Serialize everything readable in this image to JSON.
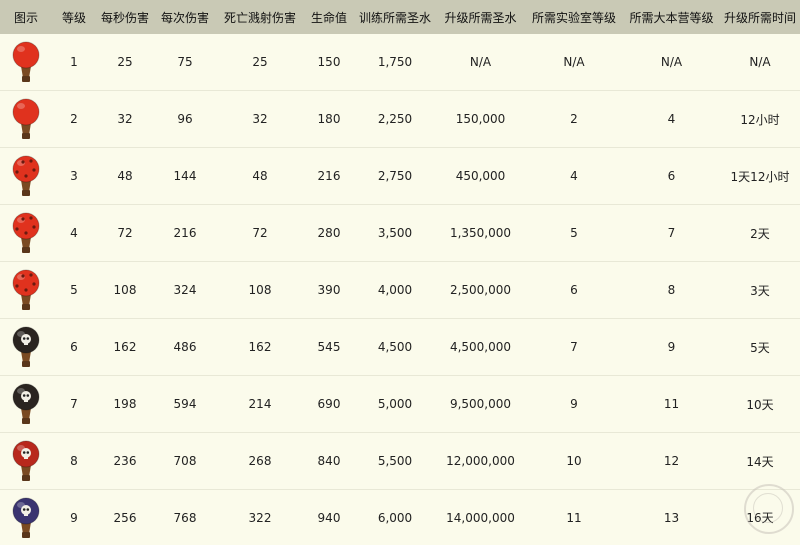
{
  "columns": [
    "图示",
    "等级",
    "每秒伤害",
    "每次伤害",
    "死亡溅射伤害",
    "生命值",
    "训练所需圣水",
    "升级所需圣水",
    "所需实验室等级",
    "所需大本营等级",
    "升级所需时间"
  ],
  "balloon_colors": {
    "red": "#e0321e",
    "skull": "#2a2420",
    "purple": "#3a3470",
    "basket": "#7a4a22"
  },
  "rows": [
    {
      "icon": "balloon-red-icon",
      "level": "1",
      "dps": "25",
      "damage_per_hit": "75",
      "death_damage": "25",
      "hitpoints": "150",
      "training_cost": "1,750",
      "upgrade_cost": "N/A",
      "lab_level": "N/A",
      "town_hall": "N/A",
      "upgrade_time": "N/A"
    },
    {
      "icon": "balloon-red-icon",
      "level": "2",
      "dps": "32",
      "damage_per_hit": "96",
      "death_damage": "32",
      "hitpoints": "180",
      "training_cost": "2,250",
      "upgrade_cost": "150,000",
      "lab_level": "2",
      "town_hall": "4",
      "upgrade_time": "12小时"
    },
    {
      "icon": "balloon-spiked-icon",
      "level": "3",
      "dps": "48",
      "damage_per_hit": "144",
      "death_damage": "48",
      "hitpoints": "216",
      "training_cost": "2,750",
      "upgrade_cost": "450,000",
      "lab_level": "4",
      "town_hall": "6",
      "upgrade_time": "1天12小时"
    },
    {
      "icon": "balloon-spiked-icon",
      "level": "4",
      "dps": "72",
      "damage_per_hit": "216",
      "death_damage": "72",
      "hitpoints": "280",
      "training_cost": "3,500",
      "upgrade_cost": "1,350,000",
      "lab_level": "5",
      "town_hall": "7",
      "upgrade_time": "2天"
    },
    {
      "icon": "balloon-spiked-icon",
      "level": "5",
      "dps": "108",
      "damage_per_hit": "324",
      "death_damage": "108",
      "hitpoints": "390",
      "training_cost": "4,000",
      "upgrade_cost": "2,500,000",
      "lab_level": "6",
      "town_hall": "8",
      "upgrade_time": "3天"
    },
    {
      "icon": "balloon-skull-icon",
      "level": "6",
      "dps": "162",
      "damage_per_hit": "486",
      "death_damage": "162",
      "hitpoints": "545",
      "training_cost": "4,500",
      "upgrade_cost": "4,500,000",
      "lab_level": "7",
      "town_hall": "9",
      "upgrade_time": "5天"
    },
    {
      "icon": "balloon-skull-icon",
      "level": "7",
      "dps": "198",
      "damage_per_hit": "594",
      "death_damage": "214",
      "hitpoints": "690",
      "training_cost": "5,000",
      "upgrade_cost": "9,500,000",
      "lab_level": "9",
      "town_hall": "11",
      "upgrade_time": "10天"
    },
    {
      "icon": "balloon-red-skull-icon",
      "level": "8",
      "dps": "236",
      "damage_per_hit": "708",
      "death_damage": "268",
      "hitpoints": "840",
      "training_cost": "5,500",
      "upgrade_cost": "12,000,000",
      "lab_level": "10",
      "town_hall": "12",
      "upgrade_time": "14天"
    },
    {
      "icon": "balloon-purple-skull-icon",
      "level": "9",
      "dps": "256",
      "damage_per_hit": "768",
      "death_damage": "322",
      "hitpoints": "940",
      "training_cost": "6,000",
      "upgrade_cost": "14,000,000",
      "lab_level": "11",
      "town_hall": "13",
      "upgrade_time": "16天"
    }
  ]
}
